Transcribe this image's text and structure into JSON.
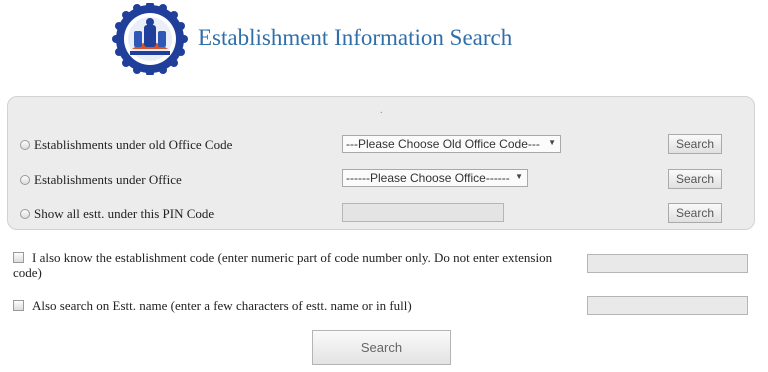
{
  "header": {
    "title": "Establishment Information Search",
    "logo_icon": "epfo-emblem-icon"
  },
  "panel": {
    "dot": ".",
    "rows": [
      {
        "label": "Establishments under old Office Code",
        "select_value": "---Please Choose Old Office Code---",
        "button": "Search"
      },
      {
        "label": "Establishments under Office",
        "select_value": "------Please Choose Office------",
        "button": "Search"
      },
      {
        "label": "Show all estt. under this PIN Code",
        "input_value": "",
        "button": "Search"
      }
    ]
  },
  "options": {
    "code_label": "I also know the establishment code (enter numeric part of code number only. Do not enter extension code)",
    "name_label": "Also search on Estt. name (enter a few characters of estt. name or in full)",
    "code_value": "",
    "name_value": ""
  },
  "search_button": "Search",
  "colors": {
    "title": "#2f6fa9",
    "panel_bg": "#ececec",
    "logo_blue": "#1f3f9a"
  }
}
